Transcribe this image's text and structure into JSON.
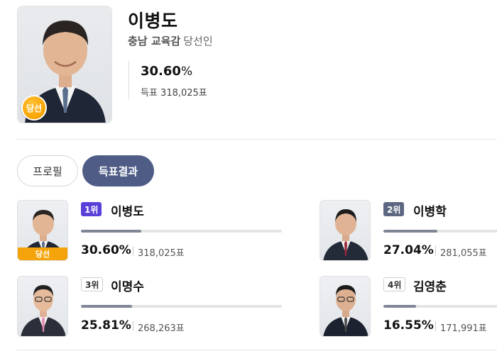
{
  "header": {
    "name": "이병도",
    "region": "충남 교육감",
    "status": "당선인",
    "percent": "30.60",
    "percent_unit": "%",
    "votes": "득표 318,025표",
    "winner_seal": "당선"
  },
  "tabs": [
    {
      "label": "프로필",
      "active": false
    },
    {
      "label": "득표결과",
      "active": true
    }
  ],
  "candidates": [
    {
      "rank": "1위",
      "name": "이병도",
      "percent": "30.60%",
      "share": 0.306,
      "votes": "318,025표",
      "winner": true,
      "winner_label": "당선",
      "tie_color": "#556b8a"
    },
    {
      "rank": "2위",
      "name": "이병학",
      "percent": "27.04%",
      "share": 0.2704,
      "votes": "281,055표",
      "winner": false,
      "tie_color": "#9b2335"
    },
    {
      "rank": "3위",
      "name": "이명수",
      "percent": "25.81%",
      "share": 0.2581,
      "votes": "268,263표",
      "winner": false,
      "tie_color": "#e48ab0"
    },
    {
      "rank": "4위",
      "name": "김영춘",
      "percent": "16.55%",
      "share": 0.1655,
      "votes": "171,991표",
      "winner": false,
      "tie_color": "#4a4a4a"
    }
  ],
  "colors": {
    "rank1_badge": "#5a3fd9",
    "rank2_badge": "#5e6781",
    "active_tab": "#4f5d86",
    "winner_gold": "#f4a40a",
    "bar_fill": "#7f8696"
  }
}
